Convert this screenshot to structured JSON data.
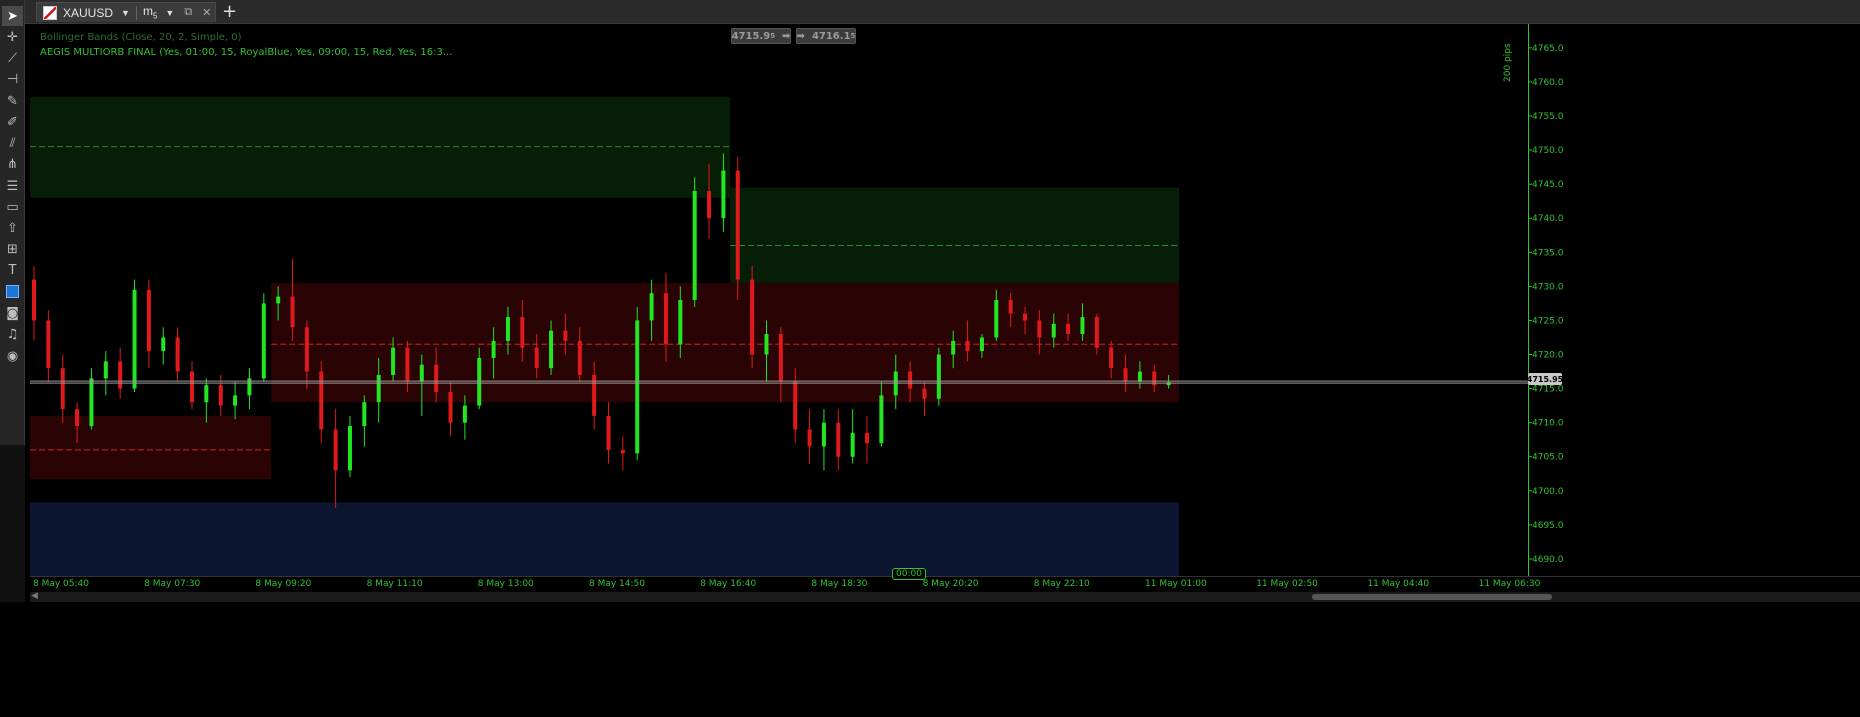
{
  "tab": {
    "symbol": "XAUUSD",
    "timeframe": "m",
    "timeframe_sub": "5"
  },
  "indicators": [
    "Bollinger Bands (Close, 20, 2, Simple, 0)",
    "AEGIS MULTIORB FINAL (Yes, 01:00, 15, RoyalBlue, Yes, 09:00, 15, Red, Yes, 16:3..."
  ],
  "quotes": {
    "sell": "4715.9",
    "sell_sub": "5",
    "buy": "4716.1",
    "buy_sub": "5"
  },
  "current_price": "4715.95",
  "ruler_label": "200 pips",
  "crosshair_time": "00:00",
  "price_axis": {
    "min": 4687.5,
    "max": 4768.5,
    "ticks": [
      "4690.0",
      "4695.0",
      "4700.0",
      "4705.0",
      "4710.0",
      "4715.0",
      "4720.0",
      "4725.0",
      "4730.0",
      "4735.0",
      "4740.0",
      "4745.0",
      "4750.0",
      "4755.0",
      "4760.0",
      "4765.0"
    ]
  },
  "time_axis": {
    "labels": [
      "8 May 05:40",
      "8 May 07:30",
      "8 May 09:20",
      "8 May 11:10",
      "8 May 13:00",
      "8 May 14:50",
      "8 May 16:40",
      "8 May 18:30",
      "8 May 20:20",
      "8 May 22:10",
      "11 May 01:00",
      "11 May 02:50",
      "11 May 04:40",
      "11 May 06:30"
    ]
  },
  "colors": {
    "up": "#22e622",
    "down": "#e01a1a",
    "axis_text": "#33c233",
    "green_box": "#061d06",
    "red_box": "#2a0404",
    "blue_box": "#0c1630"
  },
  "zones": [
    {
      "kind": "green",
      "x0": 0,
      "x1": 20.9,
      "top": 4757.8,
      "bottom": 4743.0,
      "mid": 4750.5
    },
    {
      "kind": "green",
      "x0": 20.9,
      "x1": 34.3,
      "top": 4744.5,
      "bottom": 4727.5,
      "mid": 4736.0
    },
    {
      "kind": "red",
      "x0": 0,
      "x1": 7.2,
      "top": 4711.0,
      "bottom": 4701.7,
      "mid": 4706.0
    },
    {
      "kind": "red",
      "x0": 7.2,
      "x1": 34.3,
      "top": 4730.5,
      "bottom": 4713.0,
      "mid": 4721.5
    },
    {
      "kind": "blue",
      "x0": 0,
      "x1": 34.3,
      "top": 4698.3,
      "bottom": 4687.5,
      "mid": null
    }
  ],
  "chart_data": {
    "type": "candlestick",
    "x_unit": "hours since 8 May 05:40 (session-compressed)",
    "candles": [
      [
        4731.0,
        4733.0,
        4722.0,
        4725.0
      ],
      [
        4725.0,
        4726.5,
        4716.0,
        4718.0
      ],
      [
        4718.0,
        4720.0,
        4710.0,
        4712.0
      ],
      [
        4712.0,
        4713.0,
        4707.0,
        4709.5
      ],
      [
        4709.5,
        4718.0,
        4709.0,
        4716.5
      ],
      [
        4716.5,
        4720.5,
        4714.0,
        4719.0
      ],
      [
        4719.0,
        4721.0,
        4713.5,
        4715.0
      ],
      [
        4715.0,
        4731.0,
        4714.5,
        4729.5
      ],
      [
        4729.5,
        4731.0,
        4718.0,
        4720.5
      ],
      [
        4720.5,
        4724.0,
        4718.5,
        4722.5
      ],
      [
        4722.5,
        4724.0,
        4716.0,
        4717.5
      ],
      [
        4717.5,
        4719.0,
        4712.0,
        4713.0
      ],
      [
        4713.0,
        4716.5,
        4710.0,
        4715.5
      ],
      [
        4715.5,
        4717.0,
        4711.0,
        4712.5
      ],
      [
        4712.5,
        4716.0,
        4710.5,
        4714.0
      ],
      [
        4714.0,
        4718.0,
        4712.0,
        4716.5
      ],
      [
        4716.5,
        4729.0,
        4716.0,
        4727.5
      ],
      [
        4727.5,
        4730.0,
        4725.0,
        4728.5
      ],
      [
        4728.5,
        4734.0,
        4722.0,
        4724.0
      ],
      [
        4724.0,
        4725.0,
        4715.0,
        4717.5
      ],
      [
        4717.5,
        4719.0,
        4707.0,
        4709.0
      ],
      [
        4709.0,
        4712.0,
        4697.5,
        4703.0
      ],
      [
        4703.0,
        4711.0,
        4702.0,
        4709.5
      ],
      [
        4709.5,
        4714.0,
        4706.5,
        4713.0
      ],
      [
        4713.0,
        4719.5,
        4710.0,
        4717.0
      ],
      [
        4717.0,
        4722.5,
        4716.0,
        4721.0
      ],
      [
        4721.0,
        4722.0,
        4714.5,
        4716.0
      ],
      [
        4716.0,
        4720.0,
        4711.0,
        4718.5
      ],
      [
        4718.5,
        4721.0,
        4713.0,
        4714.5
      ],
      [
        4714.5,
        4716.0,
        4708.0,
        4710.0
      ],
      [
        4710.0,
        4714.0,
        4707.5,
        4712.5
      ],
      [
        4712.5,
        4721.0,
        4712.0,
        4719.5
      ],
      [
        4719.5,
        4724.0,
        4716.5,
        4722.0
      ],
      [
        4722.0,
        4727.0,
        4720.0,
        4725.5
      ],
      [
        4725.5,
        4728.0,
        4719.0,
        4721.0
      ],
      [
        4721.0,
        4723.0,
        4716.5,
        4718.0
      ],
      [
        4718.0,
        4725.0,
        4717.0,
        4723.5
      ],
      [
        4723.5,
        4726.0,
        4720.0,
        4722.0
      ],
      [
        4722.0,
        4724.0,
        4716.0,
        4717.0
      ],
      [
        4717.0,
        4719.0,
        4709.0,
        4711.0
      ],
      [
        4711.0,
        4713.0,
        4704.0,
        4706.0
      ],
      [
        4706.0,
        4708.0,
        4703.0,
        4705.5
      ],
      [
        4705.5,
        4727.0,
        4704.5,
        4725.0
      ],
      [
        4725.0,
        4731.0,
        4722.0,
        4729.0
      ],
      [
        4729.0,
        4732.0,
        4719.0,
        4721.5
      ],
      [
        4721.5,
        4730.0,
        4719.5,
        4728.0
      ],
      [
        4728.0,
        4746.0,
        4727.0,
        4744.0
      ],
      [
        4744.0,
        4748.0,
        4737.0,
        4740.0
      ],
      [
        4740.0,
        4749.5,
        4738.0,
        4747.0
      ],
      [
        4747.0,
        4749.0,
        4728.0,
        4731.0
      ],
      [
        4731.0,
        4733.0,
        4718.0,
        4720.0
      ],
      [
        4720.0,
        4725.0,
        4716.0,
        4723.0
      ],
      [
        4723.0,
        4724.0,
        4713.0,
        4716.0
      ],
      [
        4716.0,
        4718.0,
        4707.0,
        4709.0
      ],
      [
        4709.0,
        4712.0,
        4704.0,
        4706.5
      ],
      [
        4706.5,
        4712.0,
        4703.0,
        4710.0
      ],
      [
        4710.0,
        4712.0,
        4703.0,
        4705.0
      ],
      [
        4705.0,
        4712.0,
        4704.0,
        4708.5
      ],
      [
        4708.5,
        4711.0,
        4704.0,
        4707.0
      ],
      [
        4707.0,
        4716.0,
        4706.5,
        4714.0
      ],
      [
        4714.0,
        4720.0,
        4712.0,
        4717.5
      ],
      [
        4717.5,
        4719.0,
        4713.0,
        4715.0
      ],
      [
        4715.0,
        4716.0,
        4711.0,
        4713.5
      ],
      [
        4713.5,
        4721.0,
        4712.5,
        4720.0
      ],
      [
        4720.0,
        4723.5,
        4718.0,
        4722.0
      ],
      [
        4722.0,
        4725.0,
        4719.0,
        4720.5
      ],
      [
        4720.5,
        4723.0,
        4719.5,
        4722.5
      ],
      [
        4722.5,
        4729.5,
        4722.0,
        4728.0
      ],
      [
        4728.0,
        4729.0,
        4724.0,
        4726.0
      ],
      [
        4726.0,
        4727.0,
        4723.0,
        4725.0
      ],
      [
        4725.0,
        4726.5,
        4720.0,
        4722.5
      ],
      [
        4722.5,
        4726.0,
        4721.0,
        4724.5
      ],
      [
        4724.5,
        4726.0,
        4722.0,
        4723.0
      ],
      [
        4723.0,
        4727.5,
        4722.0,
        4725.5
      ],
      [
        4725.5,
        4726.0,
        4720.0,
        4721.0
      ],
      [
        4721.0,
        4722.0,
        4716.5,
        4718.0
      ],
      [
        4718.0,
        4720.0,
        4714.5,
        4716.0
      ],
      [
        4716.0,
        4719.0,
        4715.0,
        4717.5
      ],
      [
        4717.5,
        4718.5,
        4714.5,
        4715.5
      ],
      [
        4715.5,
        4717.0,
        4715.0,
        4715.95
      ]
    ],
    "x_labels": [
      "8 May 05:40",
      "8 May 07:30",
      "8 May 09:20",
      "8 May 11:10",
      "8 May 13:00",
      "8 May 14:50",
      "8 May 16:40",
      "8 May 18:30",
      "8 May 20:20",
      "8 May 22:10",
      "11 May 01:00",
      "11 May 02:50",
      "11 May 04:40",
      "11 May 06:30"
    ],
    "ylim": [
      4687.5,
      4768.5
    ],
    "last_price": 4715.95,
    "grid": false
  }
}
